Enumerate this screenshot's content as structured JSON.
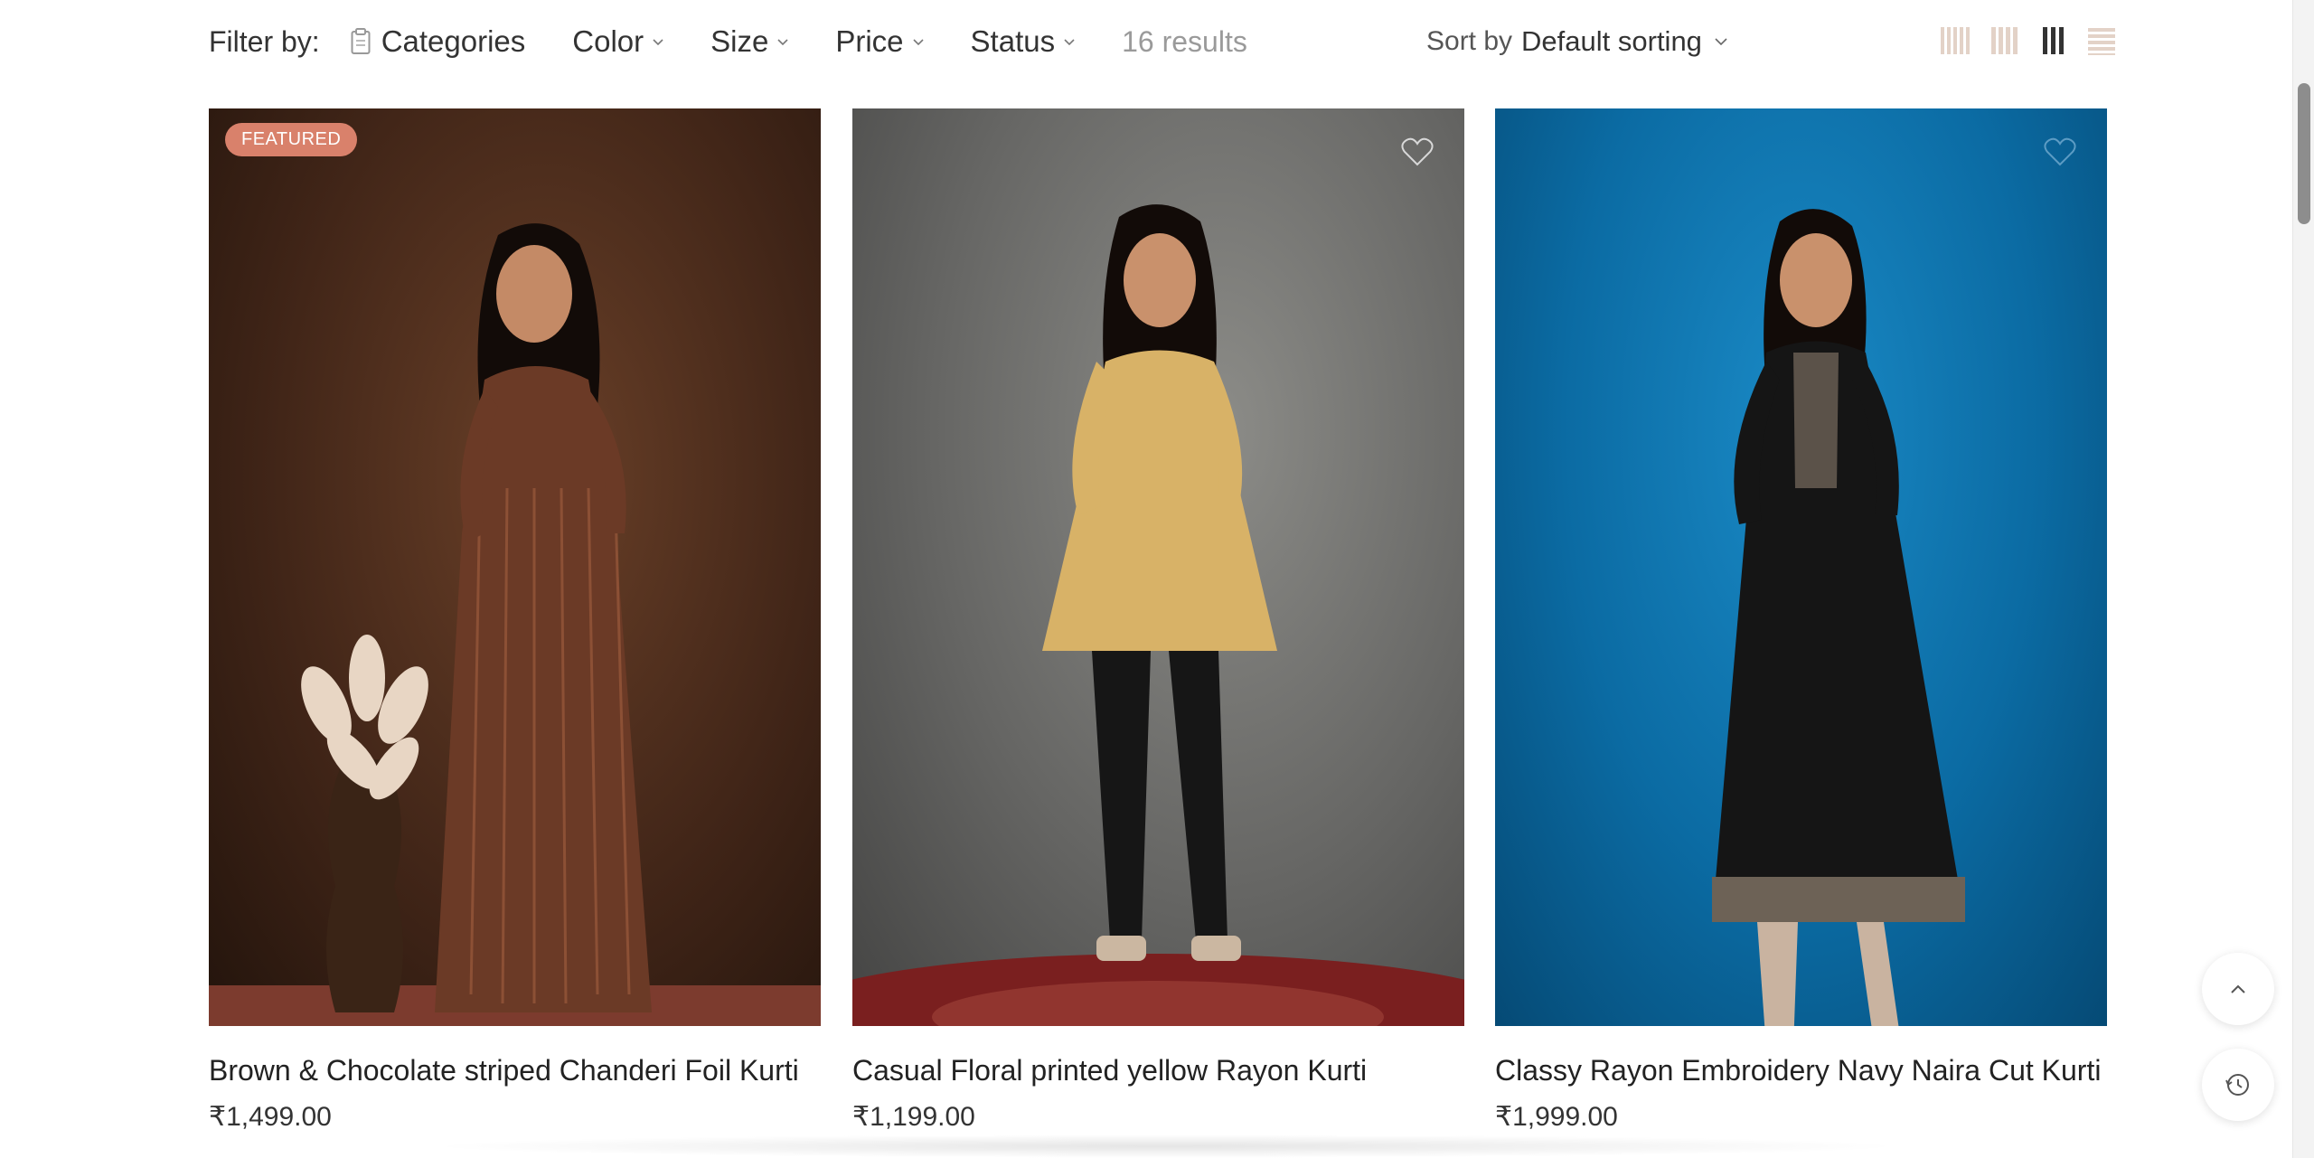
{
  "filters": {
    "label": "Filter by:",
    "items": [
      {
        "label": "Categories",
        "icon": "clipboard-icon"
      },
      {
        "label": "Color"
      },
      {
        "label": "Size"
      },
      {
        "label": "Price"
      },
      {
        "label": "Status"
      }
    ],
    "results": "16 results"
  },
  "sort": {
    "prefix": "Sort by",
    "value": "Default sorting"
  },
  "view_modes": [
    "grid-5-columns-icon",
    "grid-4-columns-icon",
    "grid-3-columns-icon",
    "list-view-icon"
  ],
  "products": [
    {
      "title": "Brown & Chocolate striped Chanderi Foil Kurti",
      "price": "₹1,499.00",
      "badge": "FEATURED",
      "bg": "#4a2c1d"
    },
    {
      "title": "Casual Floral printed yellow Rayon Kurti",
      "price": "₹1,199.00",
      "badge": "",
      "bg": "#6c6c6a"
    },
    {
      "title": "Classy Rayon Embroidery Navy Naira Cut Kurti",
      "price": "₹1,999.00",
      "badge": "",
      "bg": "#0d5f93"
    }
  ],
  "colors": {
    "badge": "#d9816b",
    "results_text": "#9a9a9a"
  }
}
